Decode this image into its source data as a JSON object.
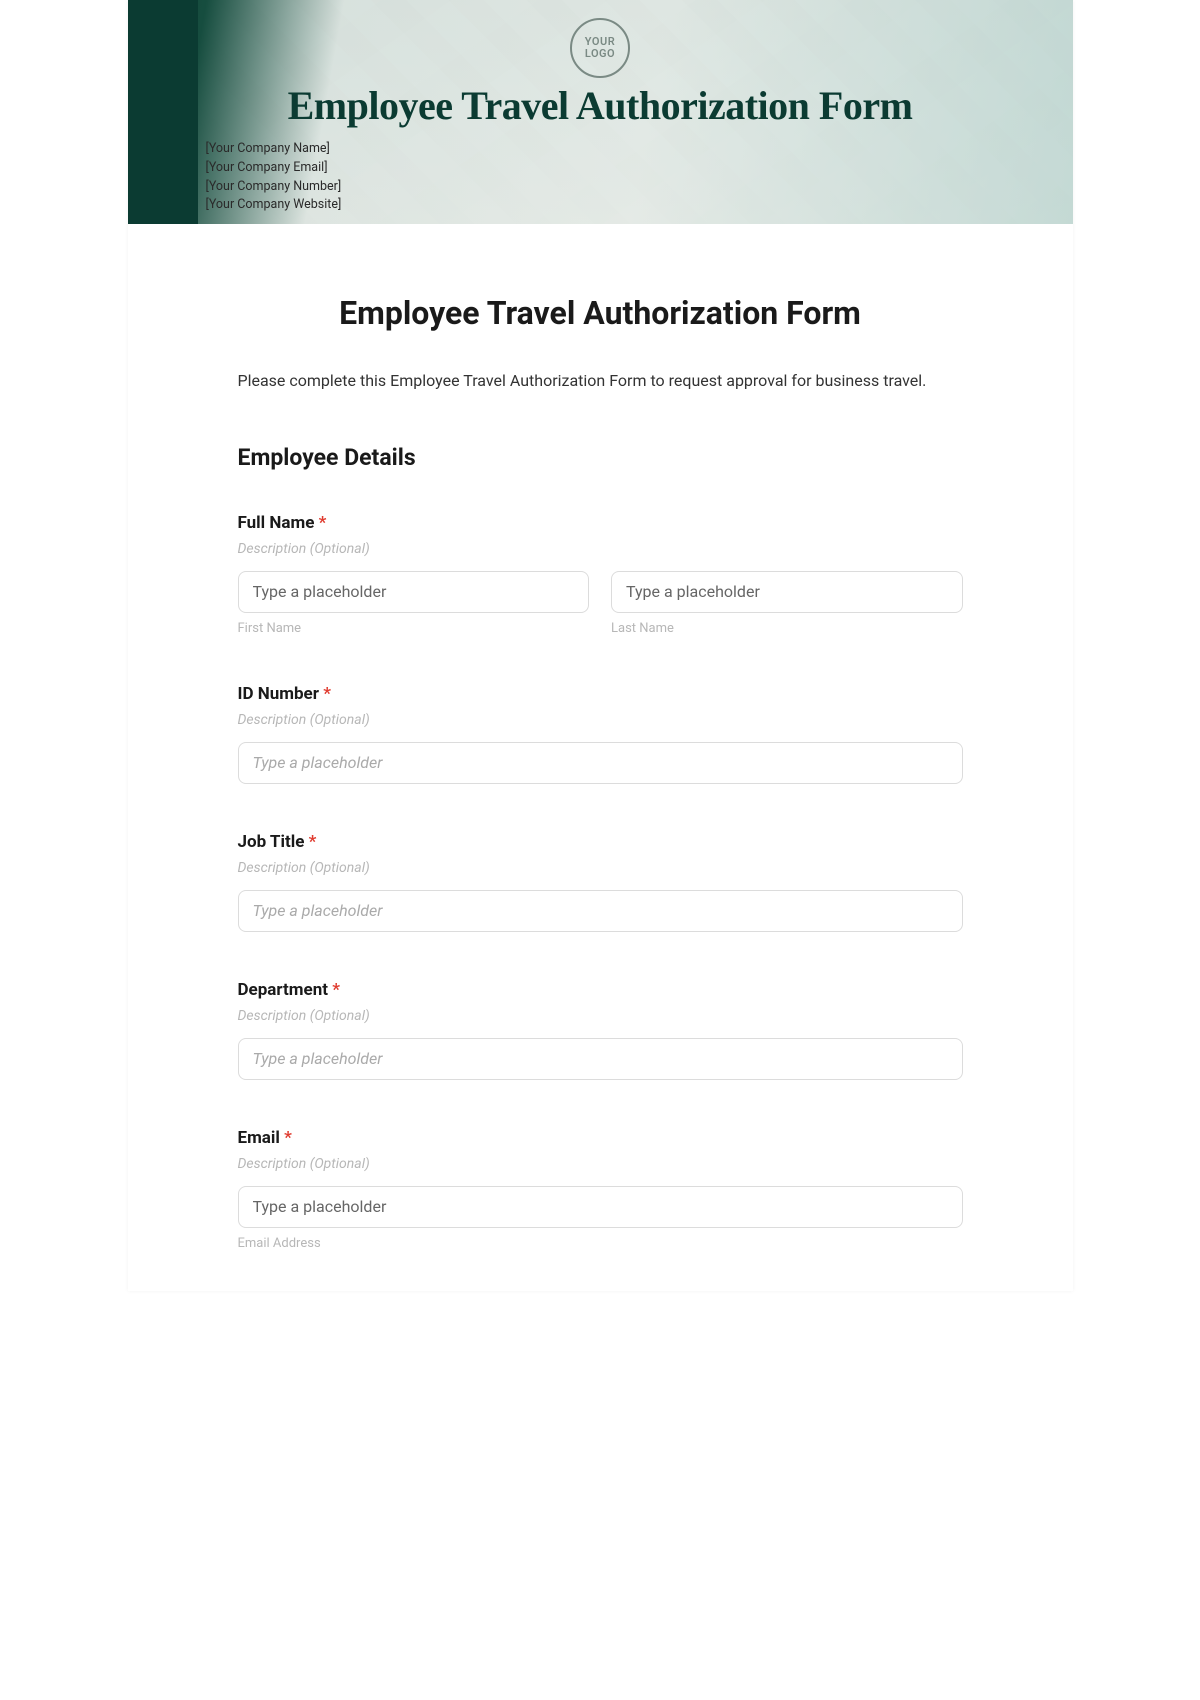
{
  "banner": {
    "logo_text": "YOUR LOGO",
    "title": "Employee Travel Authorization Form",
    "company_lines": [
      "[Your Company Name]",
      "[Your Company Email]",
      "[Your Company Number]",
      "[Your Company Website]"
    ]
  },
  "form": {
    "title": "Employee Travel Authorization Form",
    "intro": "Please complete this Employee Travel Authorization Form to request approval for business travel.",
    "section_heading": "Employee Details",
    "desc_placeholder": "Description (Optional)",
    "input_placeholder": "Type a placeholder",
    "fields": {
      "full_name": {
        "label": "Full Name",
        "first_sub": "First Name",
        "last_sub": "Last Name"
      },
      "id_number": {
        "label": "ID Number"
      },
      "job_title": {
        "label": "Job Title"
      },
      "department": {
        "label": "Department"
      },
      "email": {
        "label": "Email",
        "sub": "Email Address"
      }
    },
    "required_mark": "*"
  }
}
